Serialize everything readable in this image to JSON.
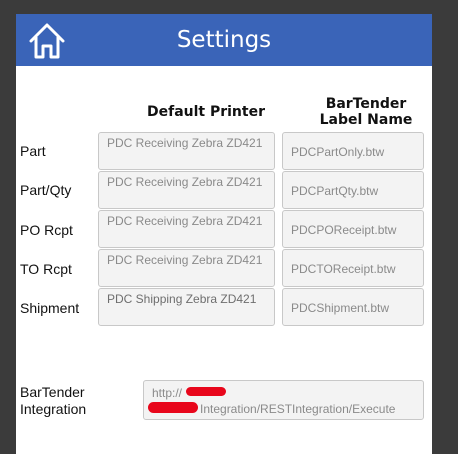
{
  "header": {
    "title": "Settings",
    "home_icon": "home-icon"
  },
  "columns": {
    "printer": "Default Printer",
    "label_line1": "BarTender",
    "label_line2": "Label Name"
  },
  "rows": [
    {
      "label": "Part",
      "printer": "PDC Receiving Zebra ZD421",
      "label_file": "PDCPartOnly.btw"
    },
    {
      "label": "Part/Qty",
      "printer": "PDC Receiving Zebra ZD421",
      "label_file": "PDCPartQty.btw"
    },
    {
      "label": "PO Rcpt",
      "printer": "PDC Receiving Zebra ZD421",
      "label_file": "PDCPOReceipt.btw"
    },
    {
      "label": "TO Rcpt",
      "printer": "PDC Receiving Zebra ZD421",
      "label_file": "PDCTOReceipt.btw"
    },
    {
      "label": "Shipment",
      "printer": "PDC Shipping Zebra ZD421",
      "label_file": "PDCShipment.btw"
    }
  ],
  "integration": {
    "label_line1": "BarTender",
    "label_line2": "Integration",
    "url_line1": "http://",
    "url_line2": "Integration/RESTIntegration/Execute"
  },
  "colors": {
    "header": "#3a64b8",
    "redaction": "#e8061b"
  }
}
